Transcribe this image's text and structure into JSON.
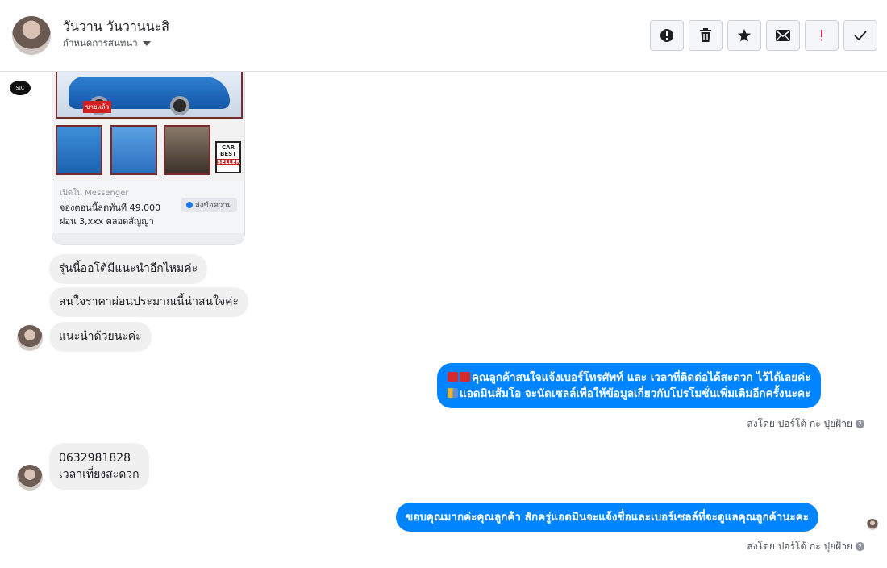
{
  "header": {
    "name": "วันวาน วันวานนะสิ",
    "sub_label": "กำหนดการสนทนา"
  },
  "actions": [
    {
      "icon": "alert-circle-icon"
    },
    {
      "icon": "trash-icon"
    },
    {
      "icon": "star-icon"
    },
    {
      "icon": "envelope-icon"
    },
    {
      "icon": "exclamation-icon"
    },
    {
      "icon": "checkmark-icon"
    }
  ],
  "card": {
    "sold_tag": "ขายแล้ว",
    "best_top": "CAR",
    "best_mid": "BEST",
    "best_bottom": "SELLER",
    "from": "เปิดใน Messenger",
    "line1": "จองตอนนี้ลดทันที 49,000",
    "line2": "ผ่อน 3,xxx ตลอดสัญญา",
    "send_button": "ส่งข้อความ"
  },
  "messages_in": [
    {
      "text": "รุ่นนี้ออโต้มีแนะนำอีกไหมค่ะ"
    },
    {
      "text": "สนใจราคาผ่อนประมาณนี้น่าสนใจค่ะ"
    },
    {
      "text": "แนะนำด้วยนะค่ะ"
    }
  ],
  "out1": {
    "line1": "คุณลูกค้าสนใจแจ้งเบอร์โทรศัพท์ และ เวลาที่ติดต่อได้สะดวก ไว้ได้เลยค่ะ",
    "line2": "แอดมินส้มโอ จะนัดเซลล์เพื่อให้ข้อมูลเกี่ยวกับโปรโมชั่นเพิ่มเติมอีกครั้งนะคะ",
    "sent_by": "ส่งโดย ปอร์โต้ กะ ปุยฝ้าย"
  },
  "in2": {
    "line1": "0632981828",
    "line2": "เวลาเที่ยงสะดวก"
  },
  "out2": {
    "text": "ขอบคุณมากค่ะคุณลูกค้า สักครู่แอดมินจะแจ้งชื่อและเบอร์เซลล์ที่จะดูแลคุณลูกค้านะคะ",
    "sent_by": "ส่งโดย ปอร์โต้ กะ ปุยฝ้าย"
  },
  "colors": {
    "accent": "#0084ff",
    "incoming_bubble": "#f1f0f0",
    "alert_red": "#e0245e"
  }
}
